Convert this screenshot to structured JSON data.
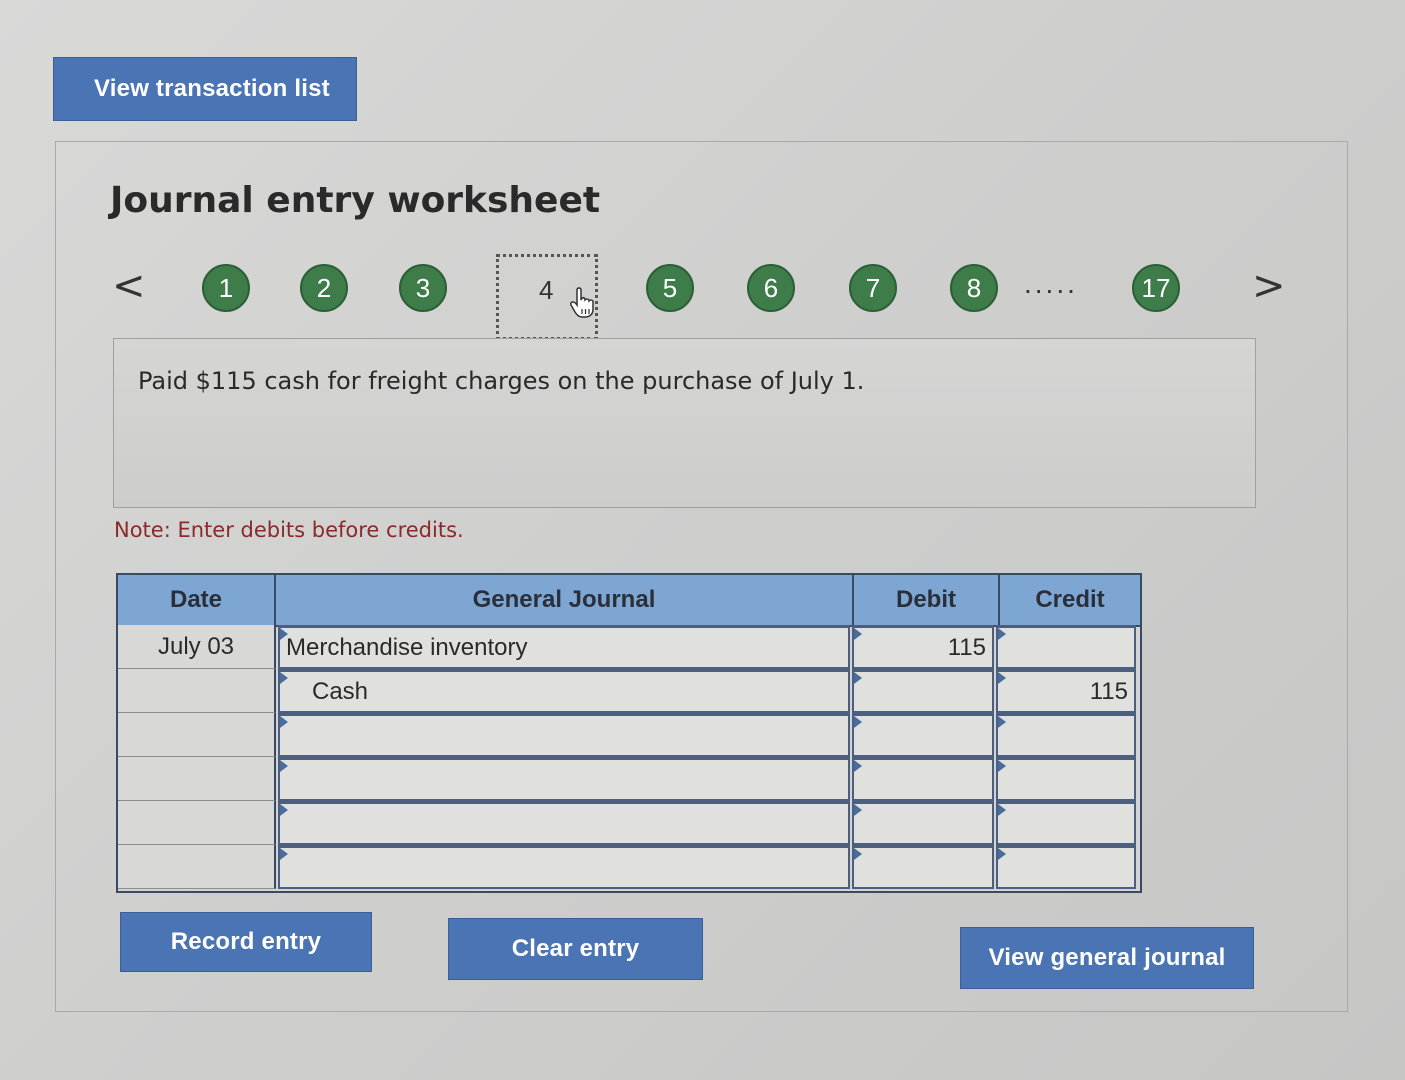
{
  "top_button": {
    "label": "View transaction list"
  },
  "worksheet": {
    "title": "Journal entry worksheet",
    "nav": {
      "prev": "<",
      "next": ">",
      "steps": [
        "1",
        "2",
        "3",
        "4",
        "5",
        "6",
        "7",
        "8",
        "17"
      ],
      "current": "4",
      "ellipsis": ".....",
      "step_color": "#3e7d4a"
    },
    "description": "Paid $115 cash for freight charges on the purchase of July 1.",
    "note": "Note: Enter debits before credits.",
    "note_color": "#8b2a2a",
    "table": {
      "headers": {
        "date": "Date",
        "journal": "General Journal",
        "debit": "Debit",
        "credit": "Credit"
      },
      "header_color": "#7ea6d3",
      "rows": [
        {
          "date": "July 03",
          "account": "Merchandise inventory",
          "debit": "115",
          "credit": ""
        },
        {
          "date": "",
          "account": "Cash",
          "debit": "",
          "credit": "115"
        },
        {
          "date": "",
          "account": "",
          "debit": "",
          "credit": ""
        },
        {
          "date": "",
          "account": "",
          "debit": "",
          "credit": ""
        },
        {
          "date": "",
          "account": "",
          "debit": "",
          "credit": ""
        },
        {
          "date": "",
          "account": "",
          "debit": "",
          "credit": ""
        }
      ]
    },
    "buttons": {
      "record": "Record entry",
      "clear": "Clear entry",
      "view_journal": "View general journal"
    },
    "button_color": "#4a74b3"
  }
}
